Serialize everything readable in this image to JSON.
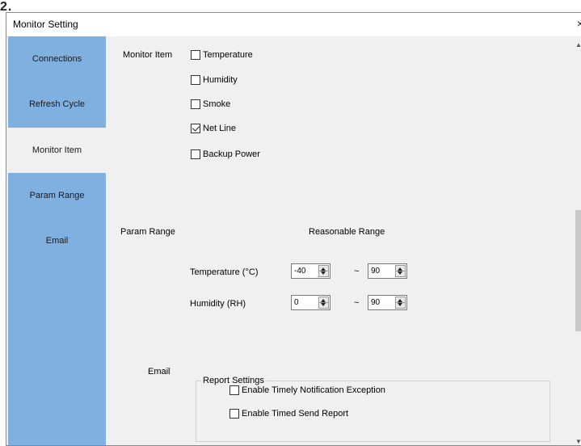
{
  "page_fragment": "2.",
  "window": {
    "title": "Monitor Setting",
    "close_glyph": "×"
  },
  "sidebar": {
    "items": [
      {
        "label": "Connections",
        "active": false
      },
      {
        "label": "Refresh Cycle",
        "active": false
      },
      {
        "label": "Monitor Item",
        "active": true
      },
      {
        "label": "Param Range",
        "active": false
      },
      {
        "label": "Email",
        "active": false
      }
    ]
  },
  "monitor_item": {
    "section_label": "Monitor Item",
    "options": [
      {
        "label": "Temperature",
        "checked": false
      },
      {
        "label": "Humidity",
        "checked": false
      },
      {
        "label": "Smoke",
        "checked": false
      },
      {
        "label": "Net Line",
        "checked": true
      },
      {
        "label": "Backup Power",
        "checked": false
      }
    ]
  },
  "param_range": {
    "section_label": "Param Range",
    "header": "Reasonable Range",
    "separator": "~",
    "rows": [
      {
        "label": "Temperature (°C)",
        "min": "-40",
        "max": "90"
      },
      {
        "label": "Humidity (RH)",
        "min": "0",
        "max": "90"
      }
    ]
  },
  "email": {
    "section_label": "Email",
    "group_title": "Report Settings",
    "options": [
      {
        "label": "Enable Timely Notification Exception",
        "checked": false
      },
      {
        "label": "Enable Timed Send Report",
        "checked": false
      }
    ]
  }
}
